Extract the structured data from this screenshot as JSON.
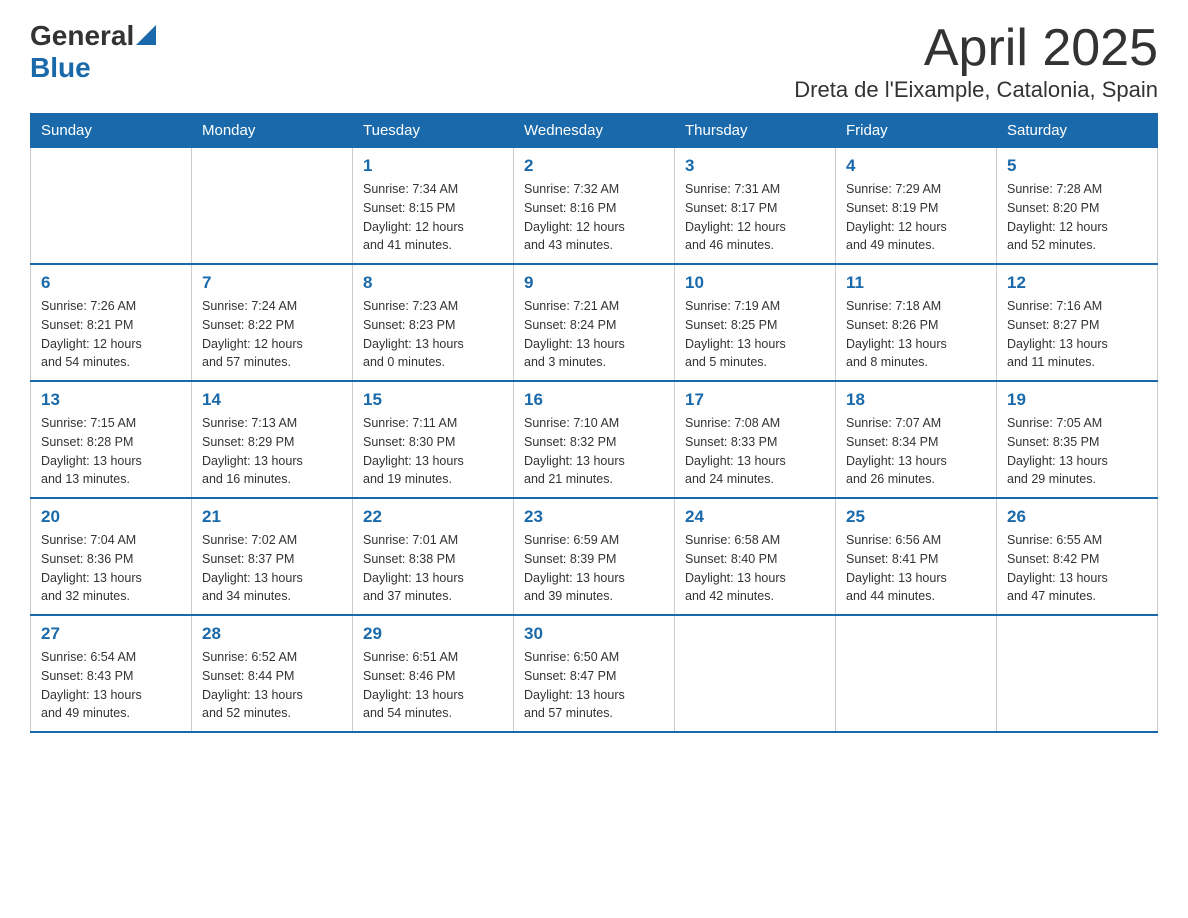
{
  "logo": {
    "general": "General",
    "blue": "Blue"
  },
  "title": "April 2025",
  "subtitle": "Dreta de l'Eixample, Catalonia, Spain",
  "headers": [
    "Sunday",
    "Monday",
    "Tuesday",
    "Wednesday",
    "Thursday",
    "Friday",
    "Saturday"
  ],
  "weeks": [
    [
      {
        "day": "",
        "info": ""
      },
      {
        "day": "",
        "info": ""
      },
      {
        "day": "1",
        "info": "Sunrise: 7:34 AM\nSunset: 8:15 PM\nDaylight: 12 hours\nand 41 minutes."
      },
      {
        "day": "2",
        "info": "Sunrise: 7:32 AM\nSunset: 8:16 PM\nDaylight: 12 hours\nand 43 minutes."
      },
      {
        "day": "3",
        "info": "Sunrise: 7:31 AM\nSunset: 8:17 PM\nDaylight: 12 hours\nand 46 minutes."
      },
      {
        "day": "4",
        "info": "Sunrise: 7:29 AM\nSunset: 8:19 PM\nDaylight: 12 hours\nand 49 minutes."
      },
      {
        "day": "5",
        "info": "Sunrise: 7:28 AM\nSunset: 8:20 PM\nDaylight: 12 hours\nand 52 minutes."
      }
    ],
    [
      {
        "day": "6",
        "info": "Sunrise: 7:26 AM\nSunset: 8:21 PM\nDaylight: 12 hours\nand 54 minutes."
      },
      {
        "day": "7",
        "info": "Sunrise: 7:24 AM\nSunset: 8:22 PM\nDaylight: 12 hours\nand 57 minutes."
      },
      {
        "day": "8",
        "info": "Sunrise: 7:23 AM\nSunset: 8:23 PM\nDaylight: 13 hours\nand 0 minutes."
      },
      {
        "day": "9",
        "info": "Sunrise: 7:21 AM\nSunset: 8:24 PM\nDaylight: 13 hours\nand 3 minutes."
      },
      {
        "day": "10",
        "info": "Sunrise: 7:19 AM\nSunset: 8:25 PM\nDaylight: 13 hours\nand 5 minutes."
      },
      {
        "day": "11",
        "info": "Sunrise: 7:18 AM\nSunset: 8:26 PM\nDaylight: 13 hours\nand 8 minutes."
      },
      {
        "day": "12",
        "info": "Sunrise: 7:16 AM\nSunset: 8:27 PM\nDaylight: 13 hours\nand 11 minutes."
      }
    ],
    [
      {
        "day": "13",
        "info": "Sunrise: 7:15 AM\nSunset: 8:28 PM\nDaylight: 13 hours\nand 13 minutes."
      },
      {
        "day": "14",
        "info": "Sunrise: 7:13 AM\nSunset: 8:29 PM\nDaylight: 13 hours\nand 16 minutes."
      },
      {
        "day": "15",
        "info": "Sunrise: 7:11 AM\nSunset: 8:30 PM\nDaylight: 13 hours\nand 19 minutes."
      },
      {
        "day": "16",
        "info": "Sunrise: 7:10 AM\nSunset: 8:32 PM\nDaylight: 13 hours\nand 21 minutes."
      },
      {
        "day": "17",
        "info": "Sunrise: 7:08 AM\nSunset: 8:33 PM\nDaylight: 13 hours\nand 24 minutes."
      },
      {
        "day": "18",
        "info": "Sunrise: 7:07 AM\nSunset: 8:34 PM\nDaylight: 13 hours\nand 26 minutes."
      },
      {
        "day": "19",
        "info": "Sunrise: 7:05 AM\nSunset: 8:35 PM\nDaylight: 13 hours\nand 29 minutes."
      }
    ],
    [
      {
        "day": "20",
        "info": "Sunrise: 7:04 AM\nSunset: 8:36 PM\nDaylight: 13 hours\nand 32 minutes."
      },
      {
        "day": "21",
        "info": "Sunrise: 7:02 AM\nSunset: 8:37 PM\nDaylight: 13 hours\nand 34 minutes."
      },
      {
        "day": "22",
        "info": "Sunrise: 7:01 AM\nSunset: 8:38 PM\nDaylight: 13 hours\nand 37 minutes."
      },
      {
        "day": "23",
        "info": "Sunrise: 6:59 AM\nSunset: 8:39 PM\nDaylight: 13 hours\nand 39 minutes."
      },
      {
        "day": "24",
        "info": "Sunrise: 6:58 AM\nSunset: 8:40 PM\nDaylight: 13 hours\nand 42 minutes."
      },
      {
        "day": "25",
        "info": "Sunrise: 6:56 AM\nSunset: 8:41 PM\nDaylight: 13 hours\nand 44 minutes."
      },
      {
        "day": "26",
        "info": "Sunrise: 6:55 AM\nSunset: 8:42 PM\nDaylight: 13 hours\nand 47 minutes."
      }
    ],
    [
      {
        "day": "27",
        "info": "Sunrise: 6:54 AM\nSunset: 8:43 PM\nDaylight: 13 hours\nand 49 minutes."
      },
      {
        "day": "28",
        "info": "Sunrise: 6:52 AM\nSunset: 8:44 PM\nDaylight: 13 hours\nand 52 minutes."
      },
      {
        "day": "29",
        "info": "Sunrise: 6:51 AM\nSunset: 8:46 PM\nDaylight: 13 hours\nand 54 minutes."
      },
      {
        "day": "30",
        "info": "Sunrise: 6:50 AM\nSunset: 8:47 PM\nDaylight: 13 hours\nand 57 minutes."
      },
      {
        "day": "",
        "info": ""
      },
      {
        "day": "",
        "info": ""
      },
      {
        "day": "",
        "info": ""
      }
    ]
  ]
}
